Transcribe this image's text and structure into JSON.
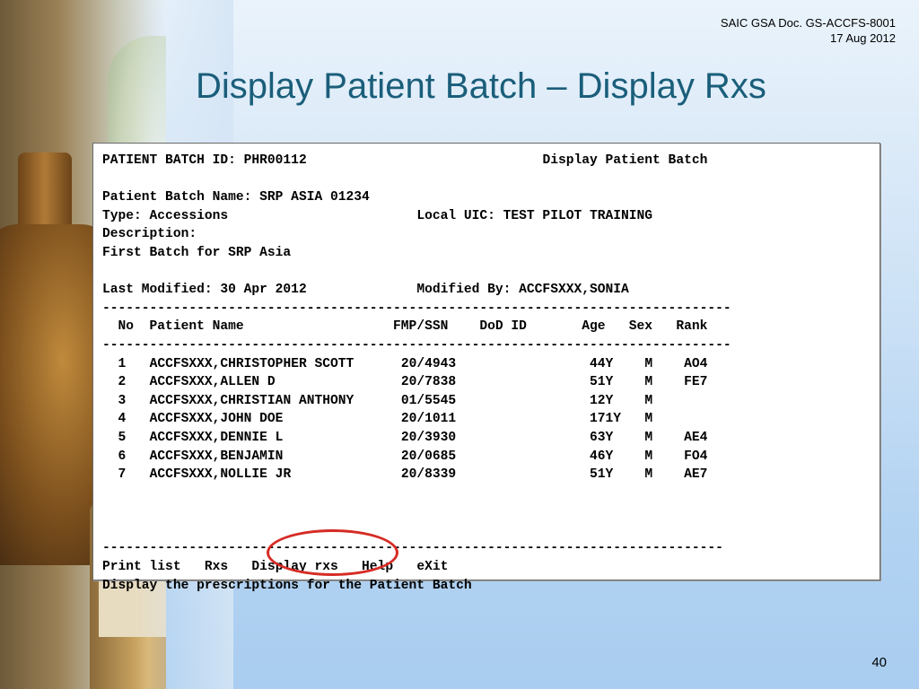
{
  "slide": {
    "doc_ref_line1": "SAIC GSA Doc. GS-ACCFS-8001",
    "doc_ref_line2": "17 Aug 2012",
    "title": "Display Patient Batch – Display Rxs",
    "page_number": "40"
  },
  "terminal": {
    "header_left": "PATIENT BATCH ID: PHR00112",
    "header_right": "Display Patient Batch",
    "batch_name": "Patient Batch Name: SRP ASIA 01234",
    "type": "Type: Accessions",
    "local_uic": "Local UIC: TEST PILOT TRAINING",
    "description_label": "Description:",
    "description_value": "First Batch for SRP Asia",
    "last_modified": "Last Modified: 30 Apr 2012",
    "modified_by": "Modified By: ACCFSXXX,SONIA",
    "separator": "--------------------------------------------------------------------------------",
    "columns": {
      "no": "No",
      "patient_name": "Patient Name",
      "fmp_ssn": "FMP/SSN",
      "dod_id": "DoD ID",
      "age": "Age",
      "sex": "Sex",
      "rank": "Rank"
    },
    "rows": [
      {
        "no": "1",
        "name": "ACCFSXXX,CHRISTOPHER SCOTT",
        "fmp_ssn": "20/4943",
        "dod_id": "",
        "age": "44Y",
        "sex": "M",
        "rank": "AO4"
      },
      {
        "no": "2",
        "name": "ACCFSXXX,ALLEN D",
        "fmp_ssn": "20/7838",
        "dod_id": "",
        "age": "51Y",
        "sex": "M",
        "rank": "FE7"
      },
      {
        "no": "3",
        "name": "ACCFSXXX,CHRISTIAN ANTHONY",
        "fmp_ssn": "01/5545",
        "dod_id": "",
        "age": "12Y",
        "sex": "M",
        "rank": ""
      },
      {
        "no": "4",
        "name": "ACCFSXXX,JOHN DOE",
        "fmp_ssn": "20/1011",
        "dod_id": "",
        "age": "171Y",
        "sex": "M",
        "rank": ""
      },
      {
        "no": "5",
        "name": "ACCFSXXX,DENNIE L",
        "fmp_ssn": "20/3930",
        "dod_id": "",
        "age": "63Y",
        "sex": "M",
        "rank": "AE4"
      },
      {
        "no": "6",
        "name": "ACCFSXXX,BENJAMIN",
        "fmp_ssn": "20/0685",
        "dod_id": "",
        "age": "46Y",
        "sex": "M",
        "rank": "FO4"
      },
      {
        "no": "7",
        "name": "ACCFSXXX,NOLLIE JR",
        "fmp_ssn": "20/8339",
        "dod_id": "",
        "age": "51Y",
        "sex": "M",
        "rank": "AE7"
      }
    ],
    "footer_separator": "-------------------------------------------------------------------------------",
    "actions": {
      "print_list": "Print list",
      "rxs": "Rxs",
      "display_rxs": "Display rxs",
      "help": "Help",
      "exit": "eXit"
    },
    "status_message": "Display the prescriptions for the Patient Batch"
  },
  "colors": {
    "title": "#1a5e7a",
    "highlight_circle": "#d62b25"
  }
}
